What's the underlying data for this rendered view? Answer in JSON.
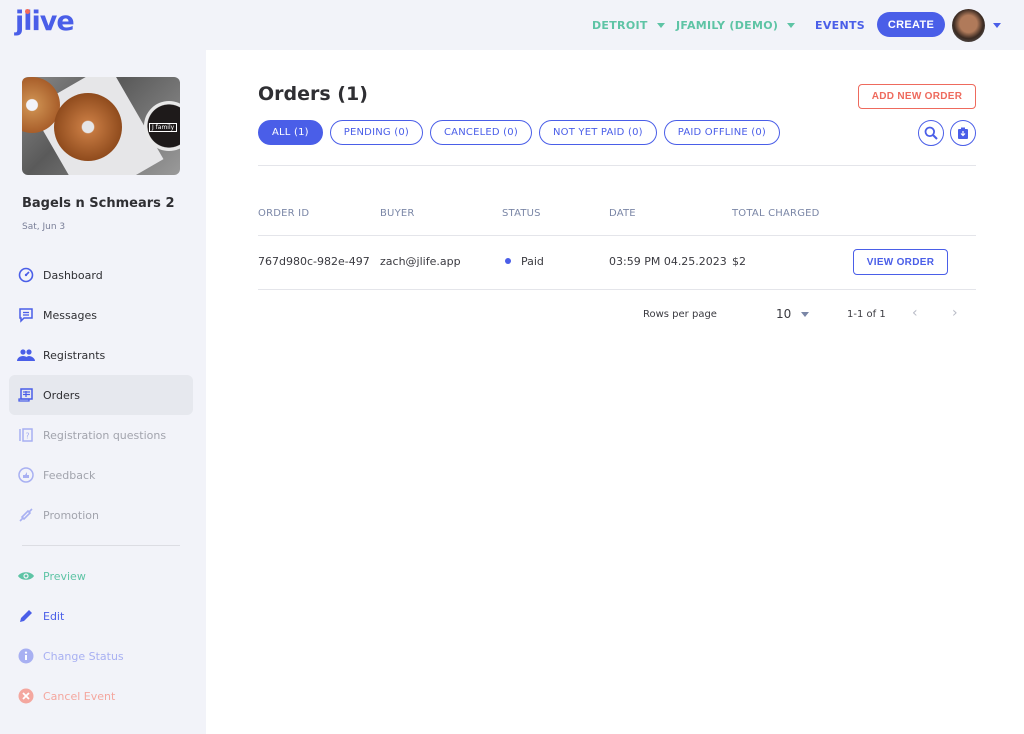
{
  "header": {
    "logo": "jlive",
    "location": "DETROIT",
    "organization": "JFAMILY (DEMO)",
    "events_link": "EVENTS",
    "create_label": "CREATE"
  },
  "colors": {
    "brand_blue": "#4a5ee8",
    "teal": "#5ec4a5",
    "coral": "#ee6a5d",
    "sidebar_bg": "#f2f3f9"
  },
  "event": {
    "title": "Bagels n Schmears 2",
    "date": "Sat, Jun 3",
    "image_badge": "J family"
  },
  "sidebar": {
    "items": [
      {
        "label": "Dashboard",
        "icon": "dashboard-icon"
      },
      {
        "label": "Messages",
        "icon": "message-icon"
      },
      {
        "label": "Registrants",
        "icon": "people-icon"
      },
      {
        "label": "Orders",
        "icon": "receipt-icon",
        "active": true
      },
      {
        "label": "Registration questions",
        "icon": "question-icon"
      },
      {
        "label": "Feedback",
        "icon": "thumbs-up-icon"
      },
      {
        "label": "Promotion",
        "icon": "plug-icon"
      }
    ],
    "actions": [
      {
        "label": "Preview",
        "icon": "eye-icon"
      },
      {
        "label": "Edit",
        "icon": "pencil-icon"
      },
      {
        "label": "Change Status",
        "icon": "info-icon"
      },
      {
        "label": "Cancel Event",
        "icon": "cancel-icon"
      }
    ]
  },
  "main": {
    "title": "Orders (1)",
    "add_order_label": "ADD NEW ORDER",
    "filters": [
      {
        "label": "ALL (1)",
        "active": true
      },
      {
        "label": "PENDING (0)"
      },
      {
        "label": "CANCELED (0)"
      },
      {
        "label": "NOT YET PAID (0)"
      },
      {
        "label": "PAID OFFLINE (0)"
      }
    ],
    "table": {
      "columns": [
        "ORDER ID",
        "BUYER",
        "STATUS",
        "DATE",
        "TOTAL CHARGED"
      ],
      "rows": [
        {
          "order_id": "767d980c-982e-497",
          "buyer": "zach@jlife.app",
          "status": "Paid",
          "date": "03:59 PM 04.25.2023",
          "total": "$2",
          "action": "VIEW ORDER"
        }
      ]
    },
    "pagination": {
      "rows_per_page_label": "Rows per page",
      "rows_per_page": "10",
      "range": "1-1 of 1",
      "prev": "‹",
      "next": "›"
    }
  }
}
